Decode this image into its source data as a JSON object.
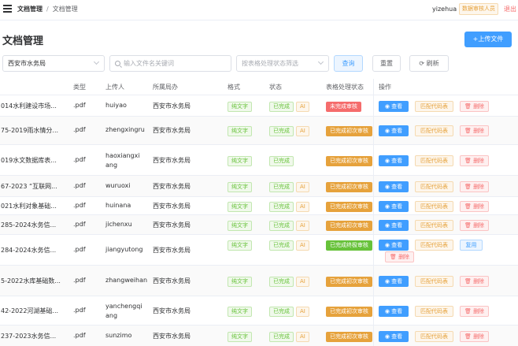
{
  "header": {
    "breadcrumb": [
      "文档管理",
      "文档管理"
    ],
    "user": "yizehua",
    "role": "数据审核人员",
    "logout": "退出"
  },
  "page": {
    "title": "文档管理",
    "upload_button": "+上传文件"
  },
  "filters": {
    "agency_value": "西安市水务局",
    "search_placeholder": "输入文件名关键词",
    "status_placeholder": "按表格处理状态筛选",
    "query_button": "查询",
    "reset_button": "重置",
    "refresh_button": "刷新"
  },
  "table": {
    "columns": [
      "类型",
      "上传人",
      "所属局办",
      "格式",
      "状态",
      "表格处理状态",
      "操作"
    ],
    "rows": [
      {
        "name": "014水利建设市场...",
        "type": ".pdf",
        "uploader": "huiyao",
        "agency": "西安市水务局",
        "format": "纯文字",
        "status": "已完成",
        "ai": "AI",
        "table_status": "未完成审核",
        "ts_kind": "red"
      },
      {
        "name": "75-2019雨水情分...",
        "type": ".pdf",
        "uploader": "zhengxingru",
        "agency": "西安市水务局",
        "format": "纯文字",
        "status": "已完成",
        "ai": "AI",
        "table_status": "已完成初次审核",
        "ts_kind": "orange"
      },
      {
        "name": "019水文数据库表...",
        "type": ".pdf",
        "uploader": "haoxiangxiang",
        "agency": "西安市水务局",
        "format": "纯文字",
        "status": "已完成",
        "ai": "",
        "table_status": "已完成初次审核",
        "ts_kind": "orange"
      },
      {
        "name": "67-2023 “互联网...",
        "type": ".pdf",
        "uploader": "wuruoxi",
        "agency": "西安市水务局",
        "format": "纯文字",
        "status": "已完成",
        "ai": "AI",
        "table_status": "已完成初次审核",
        "ts_kind": "orange"
      },
      {
        "name": "021水利对象基础...",
        "type": ".pdf",
        "uploader": "huinana",
        "agency": "西安市水务局",
        "format": "纯文字",
        "status": "已完成",
        "ai": "AI",
        "table_status": "已完成初次审核",
        "ts_kind": "orange"
      },
      {
        "name": "285-2024水务信...",
        "type": ".pdf",
        "uploader": "jichenxu",
        "agency": "西安市水务局",
        "format": "纯文字",
        "status": "已完成",
        "ai": "AI",
        "table_status": "已完成初次审核",
        "ts_kind": "orange"
      },
      {
        "name": "284-2024水务信...",
        "type": ".pdf",
        "uploader": "jiangyutong",
        "agency": "西安市水务局",
        "format": "纯文字",
        "status": "已完成",
        "ai": "AI",
        "table_status": "已完成终极审核",
        "ts_kind": "green"
      },
      {
        "name": "5-2022水库基础数...",
        "type": ".pdf",
        "uploader": "zhangweihan",
        "agency": "西安市水务局",
        "format": "纯文字",
        "status": "已完成",
        "ai": "AI",
        "table_status": "已完成初次审核",
        "ts_kind": "orange"
      },
      {
        "name": "42-2022河湖基础...",
        "type": ".pdf",
        "uploader": "yanchengqiang",
        "agency": "西安市水务局",
        "format": "纯文字",
        "status": "已完成",
        "ai": "AI",
        "table_status": "已完成初次审核",
        "ts_kind": "orange"
      },
      {
        "name": "237-2023水务信...",
        "type": ".pdf",
        "uploader": "sunzimo",
        "agency": "西安市水务局",
        "format": "纯文字",
        "status": "已完成",
        "ai": "AI",
        "table_status": "已完成初次审核",
        "ts_kind": "orange"
      }
    ],
    "actions": {
      "view": "查看",
      "match": "匹配代码表",
      "delete": "删除",
      "reuse": "复用"
    }
  },
  "colors": {
    "primary": "#409eff",
    "success": "#67c23a",
    "warning": "#e6a23c",
    "danger": "#f56c6c"
  }
}
